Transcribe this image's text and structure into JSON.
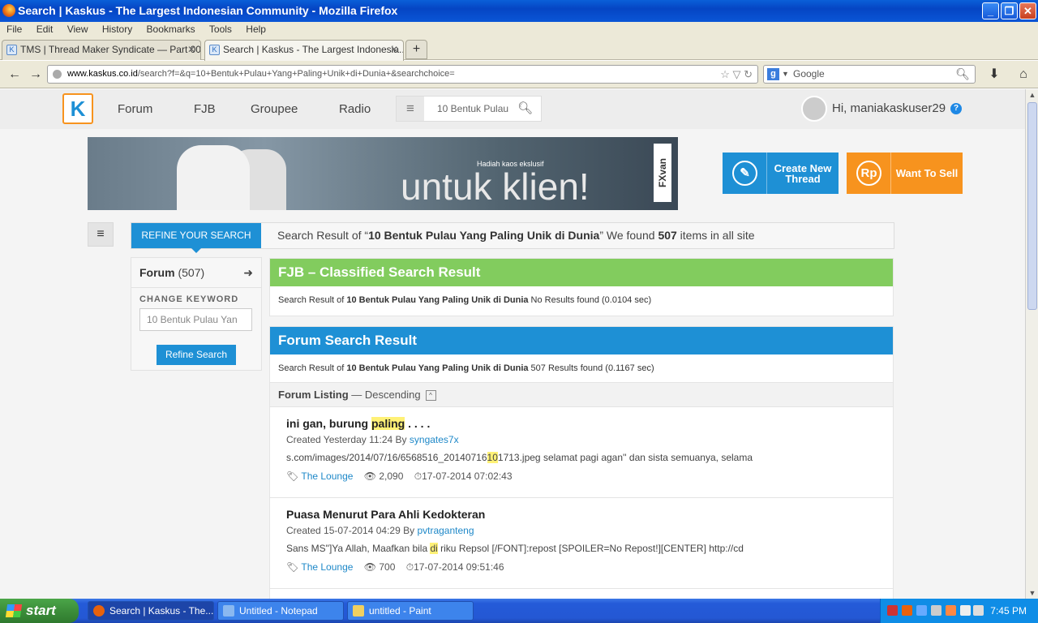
{
  "window": {
    "title": "Search | Kaskus - The Largest Indonesian Community - Mozilla Firefox",
    "buttons": {
      "minimize": "_",
      "maximize": "❐",
      "close": "✕"
    }
  },
  "menu": [
    "File",
    "Edit",
    "View",
    "History",
    "Bookmarks",
    "Tools",
    "Help"
  ],
  "tabs": [
    {
      "label": "TMS | Thread Maker Syndicate — Part 00...",
      "active": false
    },
    {
      "label": "Search | Kaskus - The Largest Indonesia...",
      "active": true
    }
  ],
  "newtab_label": "+",
  "navbar": {
    "back": "←",
    "forward": "→",
    "url_domain": "www.kaskus.co.id",
    "url_path": "/search?f=&q=10+Bentuk+Pulau+Yang+Paling+Unik+di+Dunia+&searchchoice=",
    "url_icons": "☆ ▽ ↻",
    "search_engine": "g",
    "search_placeholder": "Google",
    "download": "⬇",
    "home": "⌂"
  },
  "kaskus": {
    "logo": "K",
    "nav": [
      "Forum",
      "FJB",
      "Groupee",
      "Radio"
    ],
    "search_value": "10 Bentuk Pulau",
    "user_greeting": "Hi, maniakaskuser29",
    "help": "?"
  },
  "banner": {
    "small_text": "Hadiah kaos ekslusif",
    "big_text": "untuk klien!",
    "brand": "FXvan"
  },
  "actions": {
    "create_thread": "Create New Thread",
    "want_to_sell": "Want To Sell",
    "sell_icon": "Rp"
  },
  "refine": {
    "tab_label": "REFINE YOUR SEARCH",
    "result_prefix": "Search Result of “",
    "result_query": "10 Bentuk Pulau Yang Paling Unik di Dunia",
    "result_mid": "” We found ",
    "result_count": "507",
    "result_suffix": " items in all site"
  },
  "left_panel": {
    "forum_label": "Forum",
    "forum_count": "(507)",
    "arrow": "➜",
    "change_keyword": "CHANGE KEYWORD",
    "keyword_value": "10 Bentuk Pulau Yan",
    "refine_button": "Refine Search"
  },
  "fjb": {
    "title": "FJB – Classified Search Result",
    "sub_prefix": "Search Result of ",
    "sub_query": "10 Bentuk Pulau Yang Paling Unik di Dunia",
    "sub_suffix": "  No Results found (0.0104 sec)"
  },
  "forum_result": {
    "title": "Forum Search Result",
    "sub_prefix": "Search Result of ",
    "sub_query": "10 Bentuk Pulau Yang Paling Unik di Dunia",
    "sub_suffix": " 507 Results found (0.1167 sec)",
    "listing_label": "Forum Listing",
    "listing_order": " — Descending",
    "listing_toggle": "^"
  },
  "items": [
    {
      "title_pre": "ini gan, burung ",
      "title_hl": "paling",
      "title_post": " . . . .",
      "created_prefix": "Created Yesterday 11:24 By ",
      "author": "syngates7x",
      "snippet_pre": "s.com/images/2014/07/16/6568516_20140716",
      "snippet_hl": "10",
      "snippet_post": "1713.jpeg selamat pagi agan'' dan sista semuanya, selama",
      "category": "The Lounge",
      "views": "2,090",
      "last": "17-07-2014 07:02:43"
    },
    {
      "title_pre": "Puasa Menurut Para Ahli Kedokteran",
      "title_hl": "",
      "title_post": "",
      "created_prefix": "Created 15-07-2014 04:29 By ",
      "author": "pvtraganteng",
      "snippet_pre": "Sans MS\"]Ya Allah, Maafkan bila ",
      "snippet_hl": "di",
      "snippet_post": " riku Repsol [/FONT]:repost [SPOILER=No Repost!][CENTER] http://cd",
      "category": "The Lounge",
      "views": "700",
      "last": "17-07-2014 09:51:46"
    }
  ],
  "taskbar": {
    "start": "start",
    "items": [
      {
        "label": "Search | Kaskus - The...",
        "active": true
      },
      {
        "label": "Untitled - Notepad",
        "active": false
      },
      {
        "label": "untitled - Paint",
        "active": false
      }
    ],
    "clock": "7:45 PM"
  }
}
